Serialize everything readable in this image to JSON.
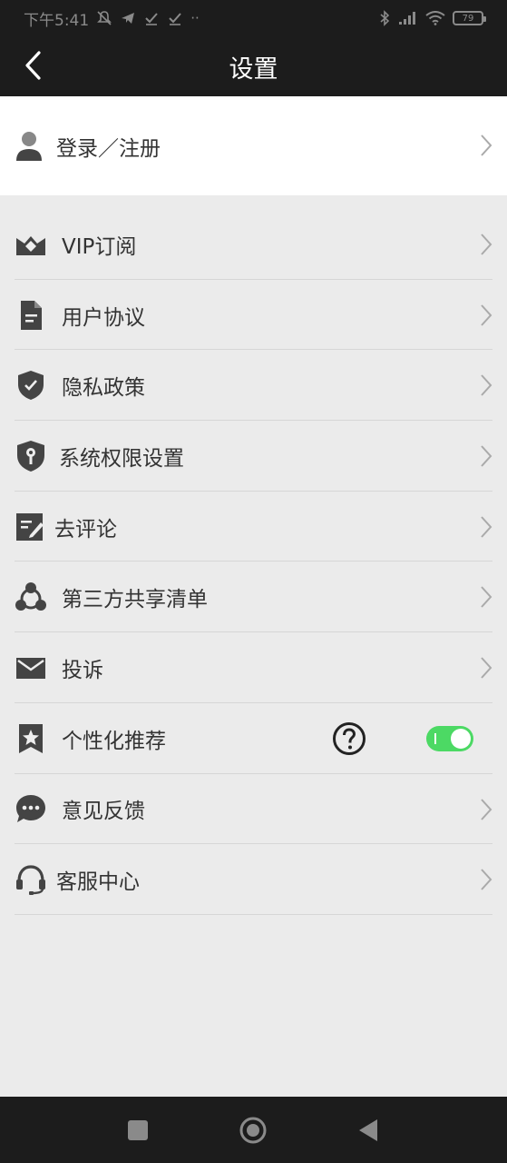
{
  "status_bar": {
    "time": "下午5:41",
    "icons_left": [
      "mute-icon",
      "telegram-icon",
      "check-icon",
      "check-icon",
      "more-dots-icon"
    ],
    "icons_right": [
      "bluetooth-icon",
      "signal-icon",
      "wifi-icon"
    ],
    "battery": "79"
  },
  "header": {
    "title": "设置",
    "back_icon": "chevron-left-icon"
  },
  "login": {
    "label": "登录／注册",
    "icon": "user-icon"
  },
  "menu": [
    {
      "id": "vip",
      "label": "VIP订阅",
      "icon": "vip-crown-icon"
    },
    {
      "id": "agreement",
      "label": "用户协议",
      "icon": "document-icon"
    },
    {
      "id": "privacy",
      "label": "隐私政策",
      "icon": "shield-check-icon"
    },
    {
      "id": "permissions",
      "label": "系统权限设置",
      "icon": "shield-key-icon"
    },
    {
      "id": "review",
      "label": "去评论",
      "icon": "edit-note-icon"
    },
    {
      "id": "share-list",
      "label": "第三方共享清单",
      "icon": "share-nodes-icon"
    },
    {
      "id": "complaint",
      "label": "投诉",
      "icon": "mail-icon"
    },
    {
      "id": "personalized",
      "label": "个性化推荐",
      "icon": "star-bookmark-icon",
      "toggle_on": true
    },
    {
      "id": "feedback",
      "label": "意见反馈",
      "icon": "chat-bubble-icon"
    },
    {
      "id": "service",
      "label": "客服中心",
      "icon": "headset-icon"
    }
  ],
  "colors": {
    "header_bg": "#1c1c1c",
    "page_bg": "#ebebeb",
    "toggle_on": "#4cd964"
  },
  "navbar": {
    "icons": [
      "square-recent-icon",
      "circle-home-icon",
      "triangle-back-icon"
    ]
  }
}
